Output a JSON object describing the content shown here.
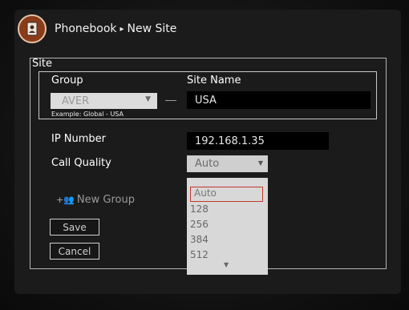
{
  "header": {
    "crumbs": [
      "Phonebook",
      "New Site"
    ],
    "separator": "▸",
    "icon": "phonebook-icon"
  },
  "site": {
    "section_label": "Site",
    "group_label": "Group",
    "group_value": "AVER",
    "site_name_label": "Site Name",
    "site_name_value": "USA",
    "example": "Example: Global - USA",
    "ip_label": "IP Number",
    "ip_value": "192.168.1.35",
    "quality_label": "Call Quality",
    "quality_value": "Auto"
  },
  "actions": {
    "new_group": "New Group",
    "save": "Save",
    "cancel": "Cancel"
  },
  "dropdown": {
    "options": [
      "Auto",
      "128",
      "256",
      "384",
      "512"
    ],
    "selected": "Auto"
  },
  "colors": {
    "accent_border": "#c0392b",
    "icon_bg": "#8a3b1a"
  }
}
